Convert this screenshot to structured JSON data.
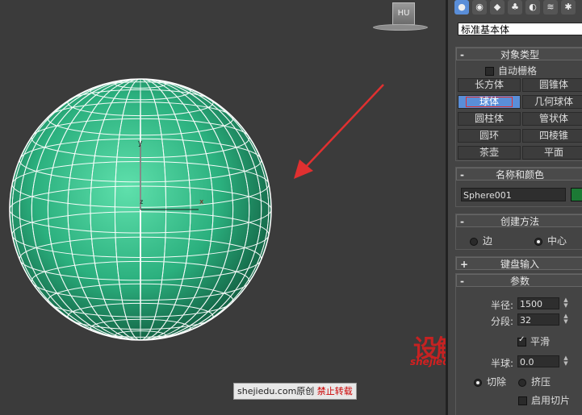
{
  "viewport": {
    "viewcube_label": "HU",
    "axis_labels": {
      "x": "x",
      "y": "y",
      "z": "z"
    },
    "watermark": {
      "site": "shejiedu.com原创",
      "notice": "禁止转载"
    },
    "logo": {
      "text": "设解读",
      "url": "shejiedu.com"
    }
  },
  "panel": {
    "toolbar_icons": [
      "create-icon",
      "modify-icon",
      "hierarchy-icon",
      "motion-icon",
      "display-icon",
      "utilities-icon",
      "extra-icon"
    ],
    "category_dropdown": "标准基本体",
    "object_type": {
      "title": "对象类型",
      "autogrid_label": "自动栅格",
      "autogrid_checked": false,
      "buttons": [
        "长方体",
        "圆锥体",
        "球体",
        "几何球体",
        "圆柱体",
        "管状体",
        "圆环",
        "四棱锥",
        "茶壶",
        "平面"
      ],
      "selected": "球体"
    },
    "name_color": {
      "title": "名称和颜色",
      "name_value": "Sphere001",
      "color": "#1c7a35"
    },
    "creation_method": {
      "title": "创建方法",
      "options": [
        "边",
        "中心"
      ],
      "selected": "中心"
    },
    "keyboard_entry": {
      "title": "键盘输入"
    },
    "parameters": {
      "title": "参数",
      "radius_label": "半径:",
      "radius_value": "1500",
      "segments_label": "分段:",
      "segments_value": "32",
      "smooth_label": "平滑",
      "smooth_checked": true,
      "hemisphere_label": "半球:",
      "hemisphere_value": "0.0",
      "chop_label": "切除",
      "squash_label": "挤压",
      "hemi_selected": "切除",
      "slice_on_label": "启用切片"
    }
  }
}
